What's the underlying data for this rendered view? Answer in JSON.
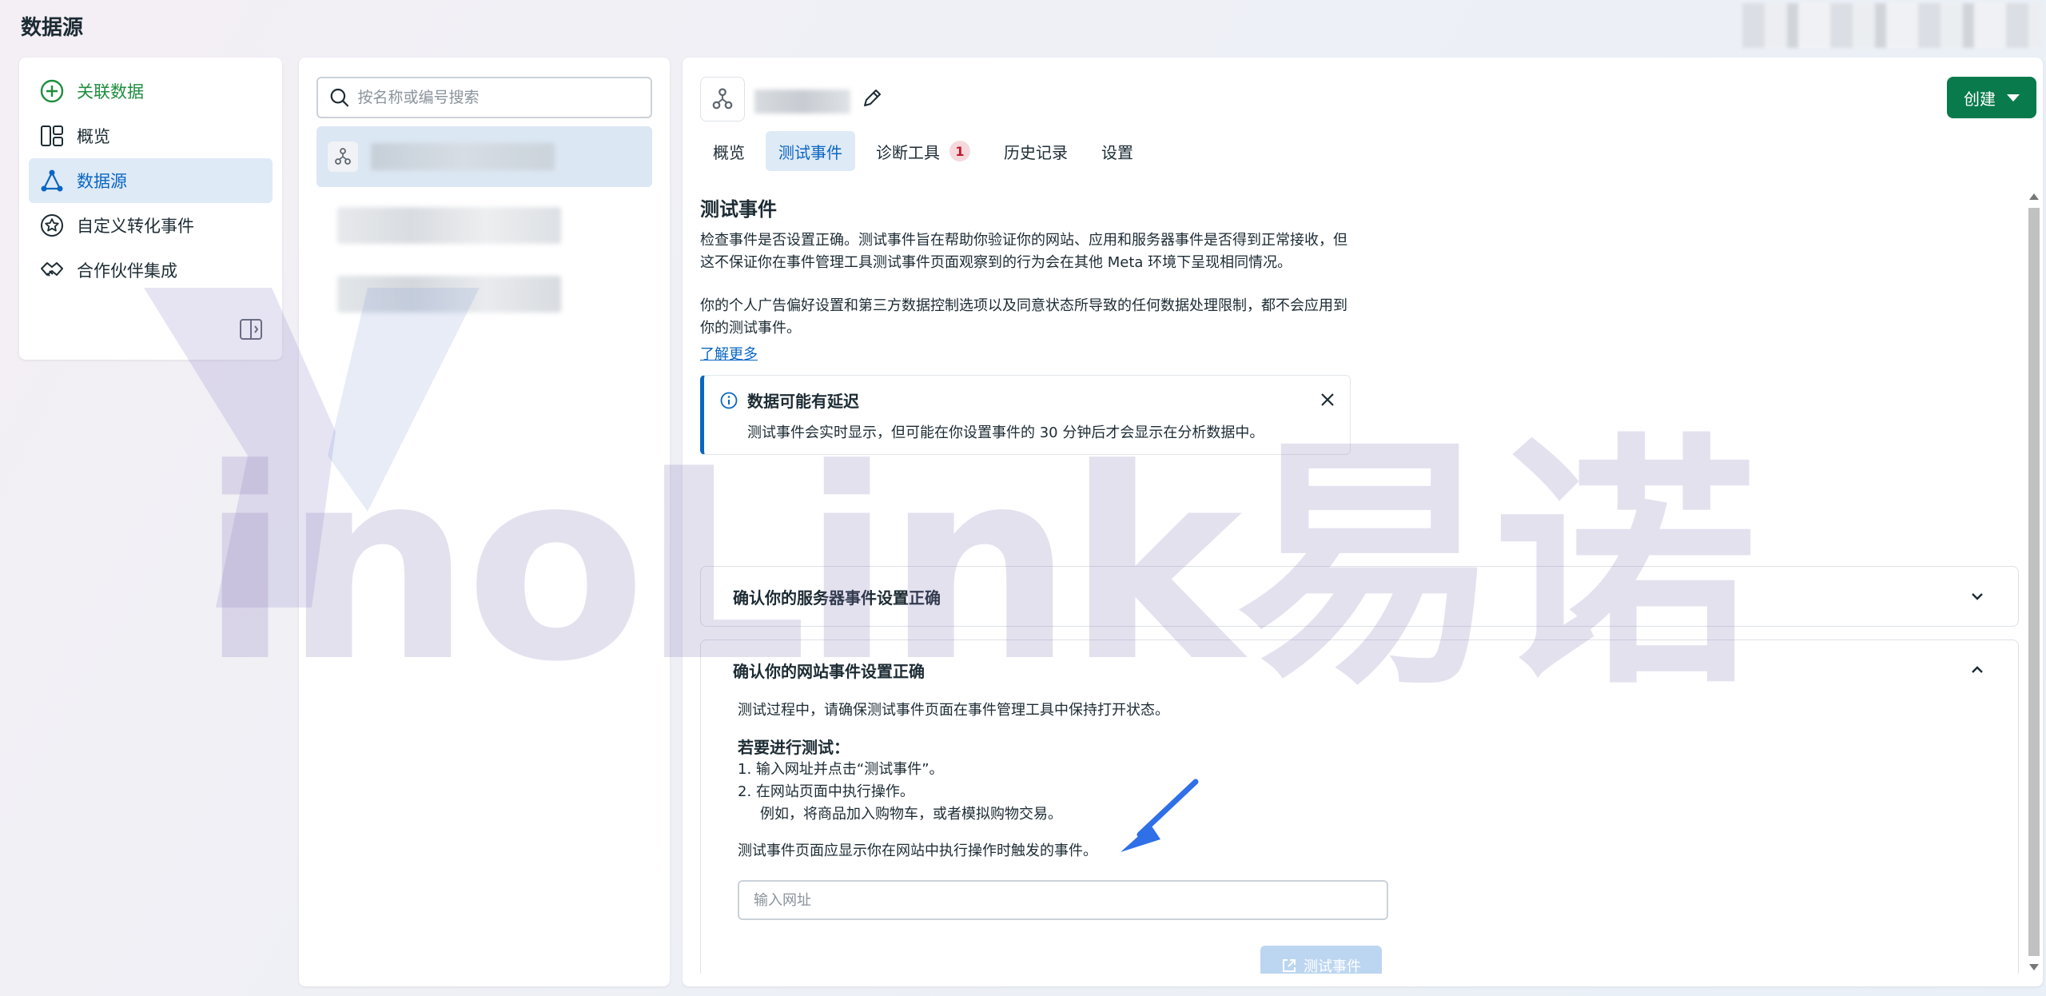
{
  "page": {
    "title": "数据源"
  },
  "nav": {
    "items": [
      {
        "label": "关联数据",
        "icon": "plus-circle-icon"
      },
      {
        "label": "概览",
        "icon": "layout-icon"
      },
      {
        "label": "数据源",
        "icon": "nodes-icon"
      },
      {
        "label": "自定义转化事件",
        "icon": "star-icon"
      },
      {
        "label": "合作伙伴集成",
        "icon": "handshake-icon"
      }
    ],
    "active": "数据源"
  },
  "list": {
    "search_placeholder": "按名称或编号搜索"
  },
  "header": {
    "create_label": "创建"
  },
  "tabs": [
    {
      "label": "概览"
    },
    {
      "label": "测试事件",
      "active": true
    },
    {
      "label": "诊断工具",
      "badge": "1"
    },
    {
      "label": "历史记录"
    },
    {
      "label": "设置"
    }
  ],
  "content": {
    "title": "测试事件",
    "para1": "检查事件是否设置正确。测试事件旨在帮助你验证你的网站、应用和服务器事件是否得到正常接收，但这不保证你在事件管理工具测试事件页面观察到的行为会在其他 Meta 环境下呈现相同情况。",
    "para2": "你的个人广告偏好设置和第三方数据控制选项以及同意状态所导致的任何数据处理限制，都不会应用到你的测试事件。",
    "learn_more": "了解更多",
    "notice": {
      "title": "数据可能有延迟",
      "body": "测试事件会实时显示，但可能在你设置事件的 30 分钟后才会显示在分析数据中。"
    },
    "server_section": {
      "title": "确认你的服务器事件设置正确"
    },
    "web_section": {
      "title": "确认你的网站事件设置正确",
      "intro": "测试过程中，请确保测试事件页面在事件管理工具中保持打开状态。",
      "steps_title": "若要进行测试：",
      "step1": "1.  输入网址并点击“测试事件”。",
      "step2": "2.  在网站页面中执行操作。",
      "step2_example": "例如，将商品加入购物车，或者模拟购物交易。",
      "outro": "测试事件页面应显示你在网站中执行操作时触发的事件。",
      "url_placeholder": "输入网址",
      "test_button": "测试事件"
    }
  },
  "watermark": {
    "text": "inoLink易诺"
  },
  "colors": {
    "accent": "#0a66c2",
    "create": "#087a4b",
    "link_green": "#1e8e3e",
    "badge_red": "#c2192c"
  }
}
